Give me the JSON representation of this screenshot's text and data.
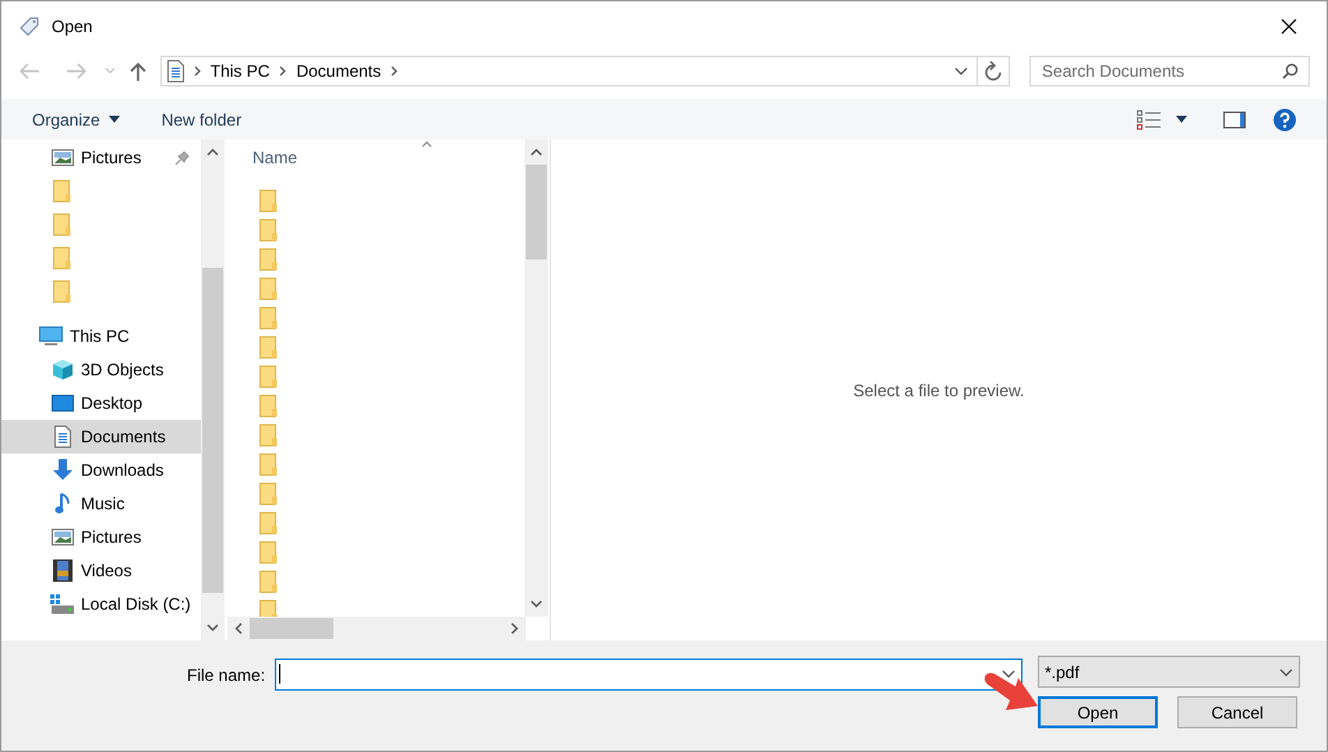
{
  "window": {
    "title": "Open"
  },
  "address": {
    "crumbs": [
      "This PC",
      "Documents"
    ]
  },
  "search": {
    "placeholder": "Search Documents"
  },
  "toolbar": {
    "organize": "Organize",
    "new_folder": "New folder"
  },
  "nav": {
    "quick_access": [
      {
        "kind": "pictures",
        "label": "Pictures",
        "pinned": true,
        "selected": false
      },
      {
        "kind": "folder",
        "selected": false
      },
      {
        "kind": "folder",
        "selected": false
      },
      {
        "kind": "folder",
        "selected": false
      },
      {
        "kind": "folder",
        "selected": false
      }
    ],
    "this_pc": {
      "kind": "pc",
      "label": "This PC",
      "selected": false,
      "children": [
        {
          "kind": "objects3d",
          "label": "3D Objects",
          "selected": false
        },
        {
          "kind": "desktop",
          "label": "Desktop",
          "selected": false
        },
        {
          "kind": "documents",
          "label": "Documents",
          "selected": true
        },
        {
          "kind": "downloads",
          "label": "Downloads",
          "selected": false
        },
        {
          "kind": "music",
          "label": "Music",
          "selected": false
        },
        {
          "kind": "pictures",
          "label": "Pictures",
          "selected": false
        },
        {
          "kind": "videos",
          "label": "Videos",
          "selected": false
        },
        {
          "kind": "disk",
          "label": "Local Disk (C:)",
          "selected": false
        }
      ]
    }
  },
  "file_list": {
    "columns": [
      "Name"
    ],
    "rows": [
      {
        "kind": "folder"
      },
      {
        "kind": "folder"
      },
      {
        "kind": "folder"
      },
      {
        "kind": "folder"
      },
      {
        "kind": "folder"
      },
      {
        "kind": "folder"
      },
      {
        "kind": "folder"
      },
      {
        "kind": "folder"
      },
      {
        "kind": "folder"
      },
      {
        "kind": "folder"
      },
      {
        "kind": "folder"
      },
      {
        "kind": "folder"
      },
      {
        "kind": "folder"
      },
      {
        "kind": "folder"
      },
      {
        "kind": "folder"
      }
    ]
  },
  "preview": {
    "message": "Select a file to preview."
  },
  "footer": {
    "file_name_label": "File name:",
    "filter": "*.pdf",
    "buttons": [
      {
        "label": "Open",
        "selected": true
      },
      {
        "label": "Cancel",
        "selected": false
      }
    ],
    "annotation_arrow": true
  }
}
